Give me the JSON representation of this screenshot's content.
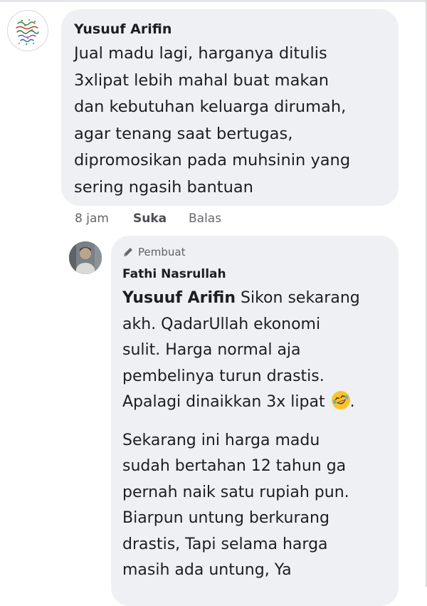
{
  "comment": {
    "author": "Yusuuf Arifin",
    "text_lines": [
      "Jual madu lagi, harganya ditulis",
      "3xlipat lebih mahal buat makan",
      "dan kebutuhan keluarga dirumah,",
      "agar tenang saat bertugas,",
      "dipromosikan pada muhsinin yang",
      "sering ngasih bantuan"
    ],
    "time": "8 jam",
    "like_label": "Suka",
    "reply_label": "Balas"
  },
  "reply": {
    "badge": "Pembuat",
    "author": "Fathi Nasrullah",
    "mention": "Yusuuf Arifin",
    "para1_first_rest": " Sikon sekarang",
    "para1_lines": [
      "akh. QadarUllah ekonomi",
      "sulit. Harga normal aja",
      "pembelinya turun drastis."
    ],
    "para1_last": "Apalagi dinaikkan 3x lipat",
    "para1_end": ".",
    "para2_lines": [
      "Sekarang ini harga madu",
      "sudah bertahan 12 tahun ga",
      "pernah naik satu rupiah pun.",
      "Biarpun untung berkurang",
      "drastis, Tapi selama harga",
      "masih ada untung, Ya"
    ]
  },
  "icons": {
    "badge_icon": "pencil-icon",
    "emoji": "rolling-on-floor-laughing-emoji"
  }
}
